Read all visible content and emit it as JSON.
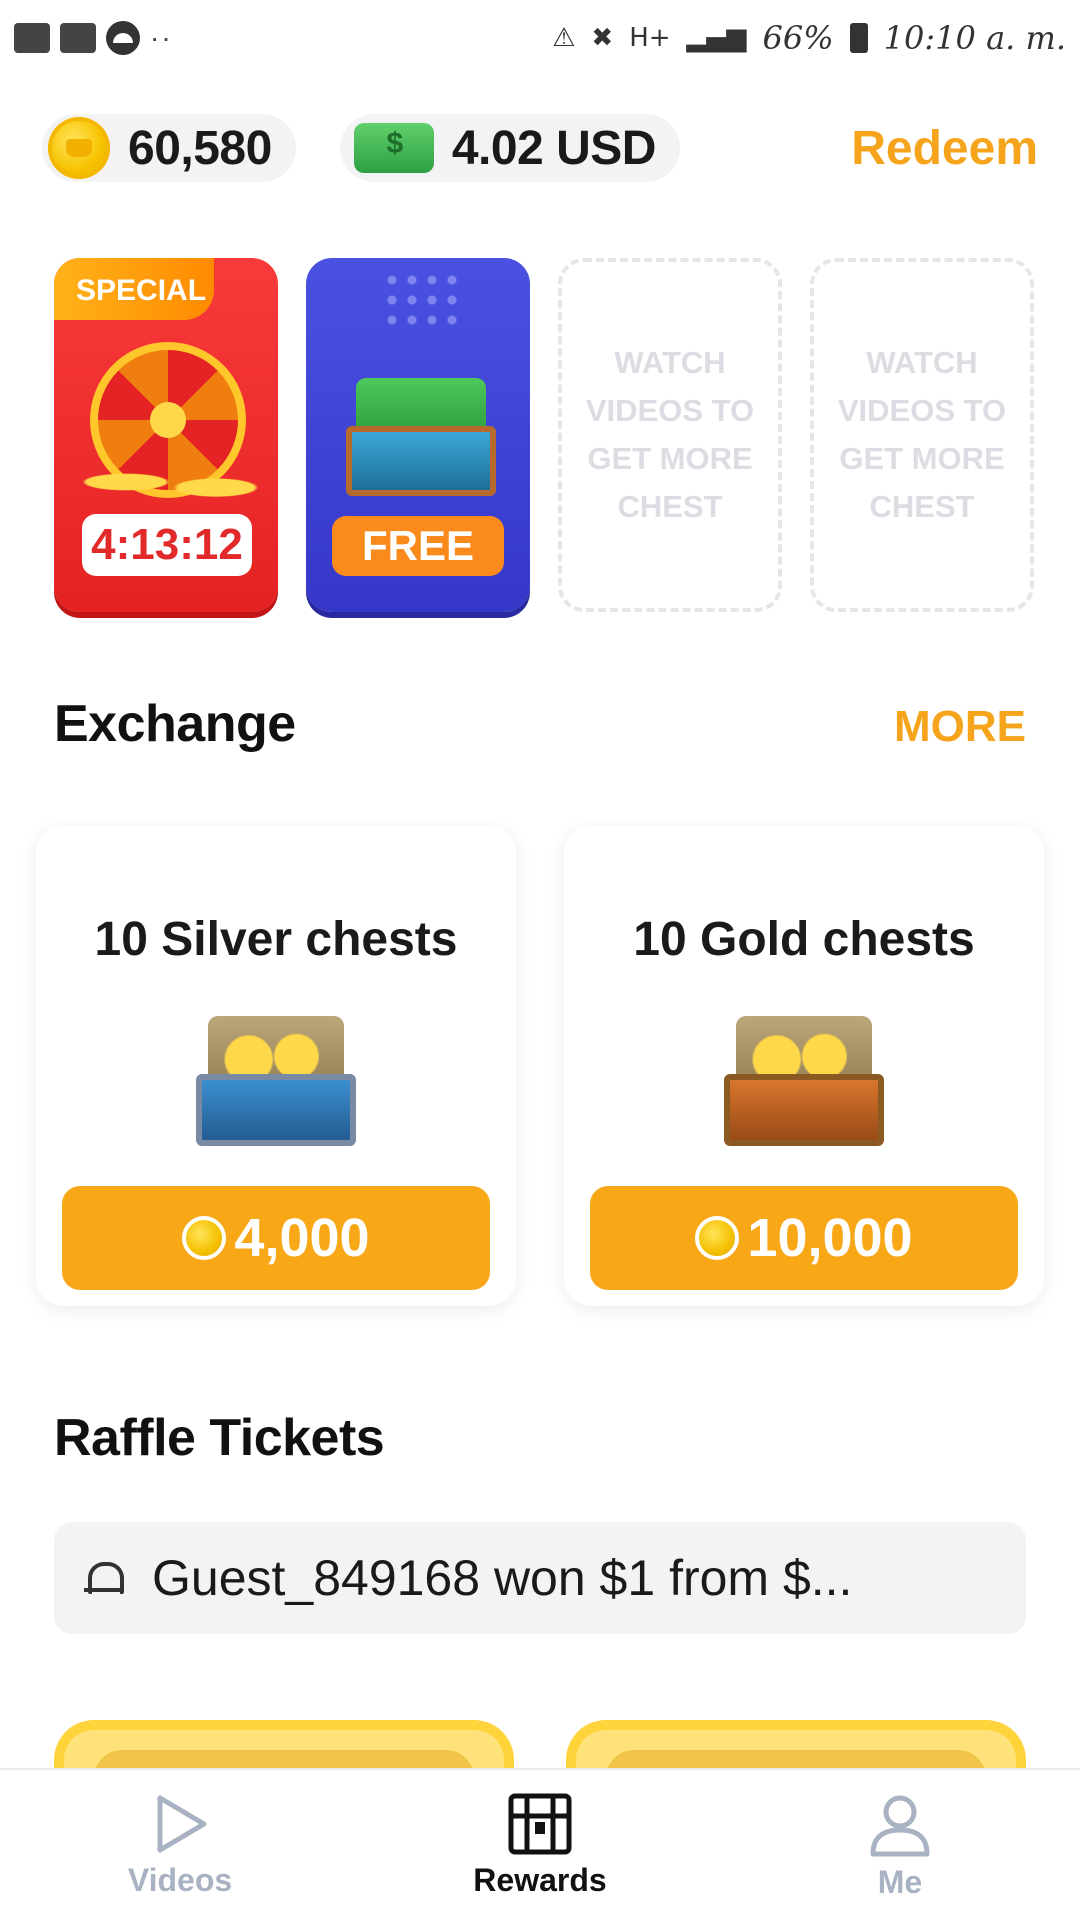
{
  "status_bar": {
    "network": "H+",
    "battery": "66%",
    "time": "10:10 a. m."
  },
  "balances": {
    "coins": "60,580",
    "cash": "4.02 USD",
    "redeem_label": "Redeem"
  },
  "chests": {
    "special_tag": "SPECIAL",
    "special_timer": "4:13:12",
    "free_label": "FREE",
    "placeholder_text": "WATCH VIDEOS TO GET MORE CHEST"
  },
  "exchange": {
    "title": "Exchange",
    "more_label": "MORE",
    "items": [
      {
        "title": "10 Silver chests",
        "price": "4,000"
      },
      {
        "title": "10 Gold chests",
        "price": "10,000"
      }
    ]
  },
  "raffle": {
    "title": "Raffle Tickets",
    "notice": "Guest_849168 won $1 from $..."
  },
  "bottom_nav": {
    "items": [
      {
        "label": "Videos",
        "icon": "play-icon"
      },
      {
        "label": "Rewards",
        "icon": "chest-icon"
      },
      {
        "label": "Me",
        "icon": "user-icon"
      }
    ]
  },
  "colors": {
    "accent": "#F6A41C",
    "special_red": "#E52222",
    "free_blue": "#3D42D6",
    "free_orange": "#FB8A1D"
  }
}
